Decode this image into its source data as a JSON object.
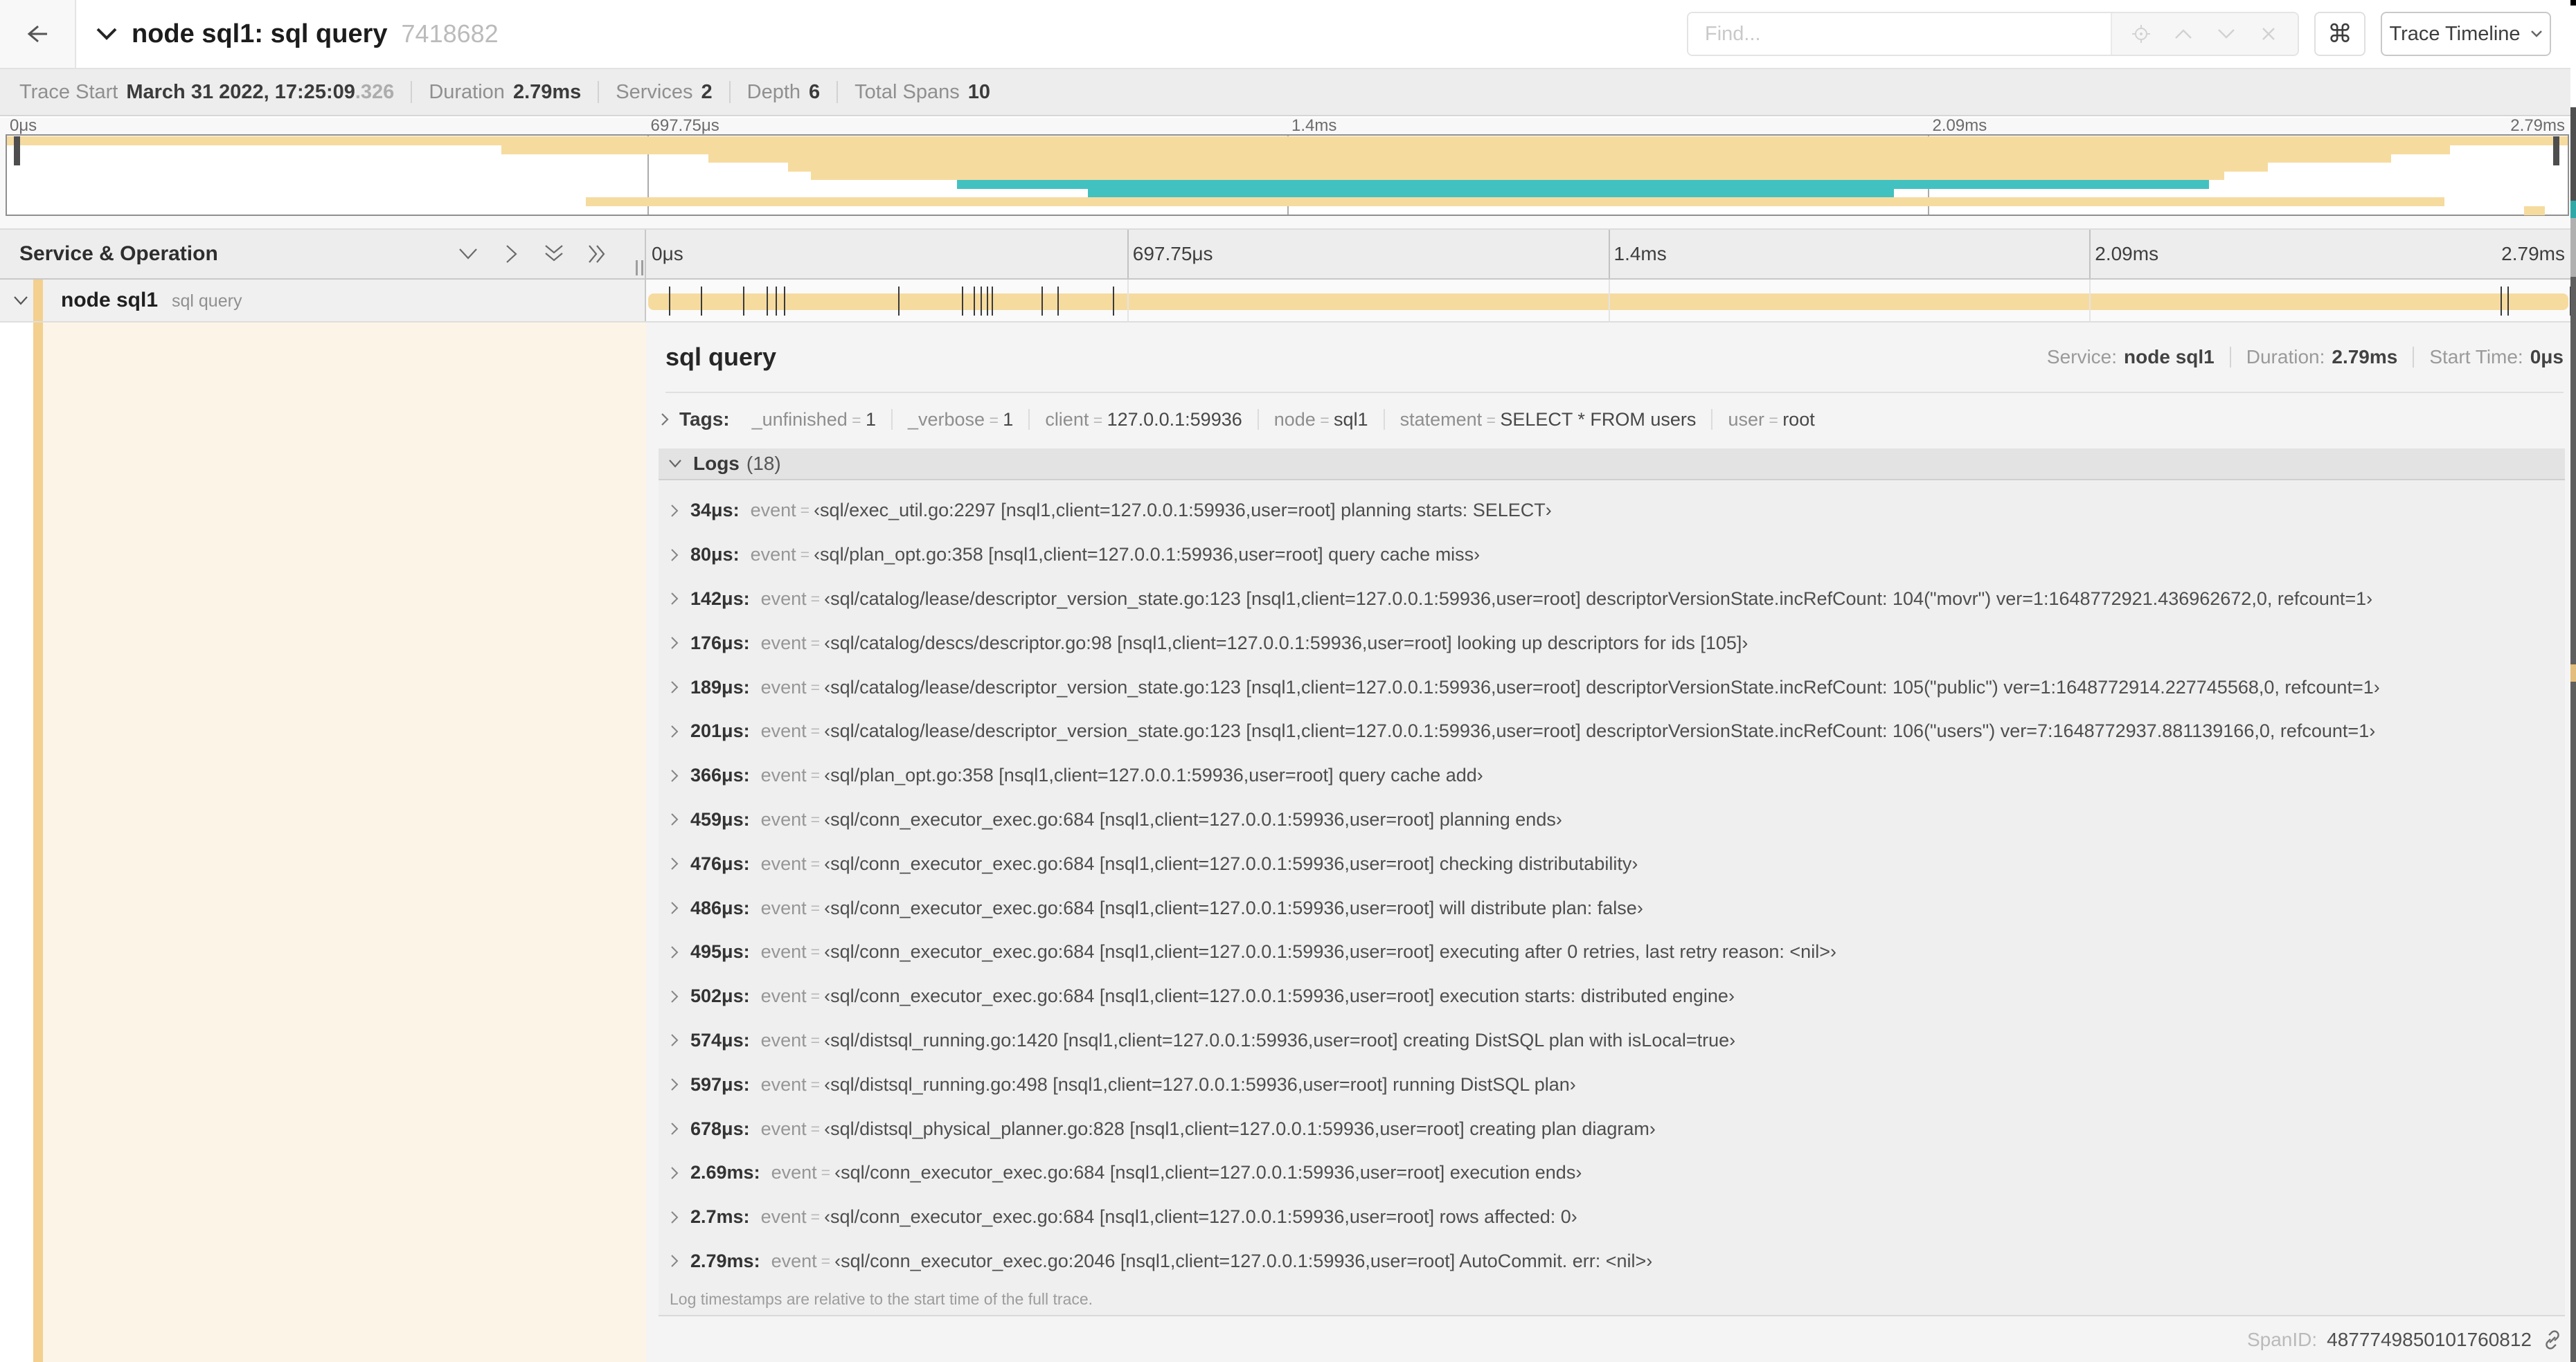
{
  "colors": {
    "tan": "#F6DB9F",
    "teal": "#42C1C1",
    "strip": "#F3D08E",
    "cream": "#FCF5E7"
  },
  "header": {
    "title": "node sql1: sql query",
    "trace_id": "7418682",
    "find_placeholder": "Find...",
    "view_selector": "Trace Timeline"
  },
  "trace_info": [
    {
      "label": "Trace Start",
      "value": "March 31 2022, 17:25:09",
      "suffix": ".326"
    },
    {
      "label": "Duration",
      "value": "2.79ms"
    },
    {
      "label": "Services",
      "value": "2"
    },
    {
      "label": "Depth",
      "value": "6"
    },
    {
      "label": "Total Spans",
      "value": "10"
    }
  ],
  "timeline": {
    "column_header": "Service & Operation",
    "total_us": 2790,
    "ticks": [
      {
        "label": "0μs",
        "pct": 0
      },
      {
        "label": "697.75μs",
        "pct": 25,
        "grid": true
      },
      {
        "label": "1.4ms",
        "pct": 50,
        "grid": true
      },
      {
        "label": "2.09ms",
        "pct": 75,
        "grid": true
      },
      {
        "label": "2.79ms",
        "pct": 100,
        "align": "right"
      }
    ]
  },
  "minimap": {
    "gridlines": [
      25,
      50,
      75
    ],
    "spans": [
      {
        "start": 0,
        "end": 100,
        "color": "tan"
      },
      {
        "start": 19.3,
        "end": 95.4,
        "color": "tan"
      },
      {
        "start": 27.4,
        "end": 93.1,
        "color": "tan"
      },
      {
        "start": 30.5,
        "end": 88.3,
        "color": "tan"
      },
      {
        "start": 31.4,
        "end": 86.6,
        "color": "tan"
      },
      {
        "start": 37.1,
        "end": 86.0,
        "color": "teal"
      },
      {
        "start": 42.2,
        "end": 73.7,
        "color": "teal"
      },
      {
        "start": 22.6,
        "end": 95.2,
        "color": "tan"
      },
      {
        "start": 98.3,
        "end": 99.1,
        "color": "tan"
      }
    ]
  },
  "span_row": {
    "service": "node sql1",
    "operation": "sql query"
  },
  "detail": {
    "title": "sql query",
    "meta": [
      {
        "label": "Service:",
        "value": "node sql1"
      },
      {
        "label": "Duration:",
        "value": "2.79ms"
      },
      {
        "label": "Start Time:",
        "value": "0μs"
      }
    ]
  },
  "tags": {
    "label": "Tags:",
    "items": [
      {
        "key": "_unfinished",
        "value": "1"
      },
      {
        "key": "_verbose",
        "value": "1"
      },
      {
        "key": "client",
        "value": "127.0.0.1:59936"
      },
      {
        "key": "node",
        "value": "sql1"
      },
      {
        "key": "statement",
        "value": "SELECT * FROM users"
      },
      {
        "key": "user",
        "value": "root"
      }
    ]
  },
  "logs": {
    "label": "Logs",
    "count": "(18)",
    "field_key": "event",
    "note": "Log timestamps are relative to the start time of the full trace.",
    "entries": [
      {
        "t": "34μs:",
        "t_us": 34,
        "value": "‹sql/exec_util.go:2297 [nsql1,client=127.0.0.1:59936,user=root] planning starts: SELECT›"
      },
      {
        "t": "80μs:",
        "t_us": 80,
        "value": "‹sql/plan_opt.go:358 [nsql1,client=127.0.0.1:59936,user=root] query cache miss›"
      },
      {
        "t": "142μs:",
        "t_us": 142,
        "value": "‹sql/catalog/lease/descriptor_version_state.go:123 [nsql1,client=127.0.0.1:59936,user=root] descriptorVersionState.incRefCount: 104(\"movr\") ver=1:1648772921.436962672,0, refcount=1›"
      },
      {
        "t": "176μs:",
        "t_us": 176,
        "value": "‹sql/catalog/descs/descriptor.go:98 [nsql1,client=127.0.0.1:59936,user=root] looking up descriptors for ids [105]›"
      },
      {
        "t": "189μs:",
        "t_us": 189,
        "value": "‹sql/catalog/lease/descriptor_version_state.go:123 [nsql1,client=127.0.0.1:59936,user=root] descriptorVersionState.incRefCount: 105(\"public\") ver=1:1648772914.227745568,0, refcount=1›"
      },
      {
        "t": "201μs:",
        "t_us": 201,
        "value": "‹sql/catalog/lease/descriptor_version_state.go:123 [nsql1,client=127.0.0.1:59936,user=root] descriptorVersionState.incRefCount: 106(\"users\") ver=7:1648772937.881139166,0, refcount=1›"
      },
      {
        "t": "366μs:",
        "t_us": 366,
        "value": "‹sql/plan_opt.go:358 [nsql1,client=127.0.0.1:59936,user=root] query cache add›"
      },
      {
        "t": "459μs:",
        "t_us": 459,
        "value": "‹sql/conn_executor_exec.go:684 [nsql1,client=127.0.0.1:59936,user=root] planning ends›"
      },
      {
        "t": "476μs:",
        "t_us": 476,
        "value": "‹sql/conn_executor_exec.go:684 [nsql1,client=127.0.0.1:59936,user=root] checking distributability›"
      },
      {
        "t": "486μs:",
        "t_us": 486,
        "value": "‹sql/conn_executor_exec.go:684 [nsql1,client=127.0.0.1:59936,user=root] will distribute plan: false›"
      },
      {
        "t": "495μs:",
        "t_us": 495,
        "value": "‹sql/conn_executor_exec.go:684 [nsql1,client=127.0.0.1:59936,user=root] executing after 0 retries, last retry reason: <nil>›"
      },
      {
        "t": "502μs:",
        "t_us": 502,
        "value": "‹sql/conn_executor_exec.go:684 [nsql1,client=127.0.0.1:59936,user=root] execution starts: distributed engine›"
      },
      {
        "t": "574μs:",
        "t_us": 574,
        "value": "‹sql/distsql_running.go:1420 [nsql1,client=127.0.0.1:59936,user=root] creating DistSQL plan with isLocal=true›"
      },
      {
        "t": "597μs:",
        "t_us": 597,
        "value": "‹sql/distsql_running.go:498 [nsql1,client=127.0.0.1:59936,user=root] running DistSQL plan›"
      },
      {
        "t": "678μs:",
        "t_us": 678,
        "value": "‹sql/distsql_physical_planner.go:828 [nsql1,client=127.0.0.1:59936,user=root] creating plan diagram›"
      },
      {
        "t": "2.69ms:",
        "t_us": 2690,
        "value": "‹sql/conn_executor_exec.go:684 [nsql1,client=127.0.0.1:59936,user=root] execution ends›"
      },
      {
        "t": "2.7ms:",
        "t_us": 2700,
        "value": "‹sql/conn_executor_exec.go:684 [nsql1,client=127.0.0.1:59936,user=root] rows affected: 0›"
      },
      {
        "t": "2.79ms:",
        "t_us": 2790,
        "value": "‹sql/conn_executor_exec.go:2046 [nsql1,client=127.0.0.1:59936,user=root] AutoCommit. err: <nil>›"
      }
    ]
  },
  "footer": {
    "spanid_label": "SpanID:",
    "spanid": "4877749850101760812"
  }
}
